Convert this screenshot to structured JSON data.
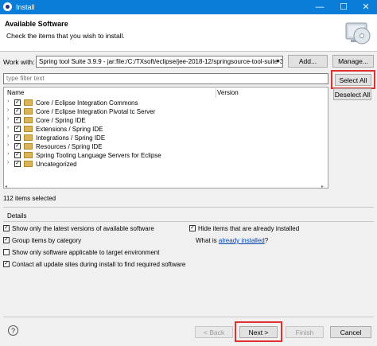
{
  "window": {
    "title": "Install",
    "minimize": "—",
    "maximize": "☐",
    "close": "✕"
  },
  "header": {
    "title": "Available Software",
    "subtitle": "Check the items that you wish to install."
  },
  "workwith": {
    "label": "Work with:",
    "value": "Spring tool Suite 3.9.9 - jar:file:/C:/TXsoft/eclipse/jee-2018-12/springsource-tool-suite-3",
    "add_label": "Add...",
    "manage_label": "Manage..."
  },
  "filter": {
    "placeholder": "type filter text"
  },
  "buttons": {
    "select_all": "Select All",
    "deselect_all": "Deselect All"
  },
  "tree": {
    "columns": [
      "Name",
      "Version"
    ],
    "items": [
      "Core / Eclipse Integration Commons",
      "Core / Eclipse Integration Pivotal tc Server",
      "Core / Spring IDE",
      "Extensions / Spring IDE",
      "Integrations / Spring IDE",
      "Resources / Spring IDE",
      "Spring Tooling Language Servers for Eclipse",
      "Uncategorized"
    ]
  },
  "status": {
    "selected": "112 items selected"
  },
  "details": {
    "label": "Details",
    "options": [
      {
        "label": "Show only the latest versions of available software",
        "checked": true
      },
      {
        "label": "Hide items that are already installed",
        "checked": true
      },
      {
        "label": "Group items by category",
        "checked": true
      },
      {
        "label": "Show only software applicable to target environment",
        "checked": false
      },
      {
        "label": "Contact all update sites during install to find required software",
        "checked": true
      }
    ],
    "what_is_prefix": "What is",
    "already_installed_link": "already installed",
    "what_is_suffix": "?"
  },
  "footer": {
    "back": "< Back",
    "next": "Next >",
    "finish": "Finish",
    "cancel": "Cancel",
    "help": "?"
  },
  "colors": {
    "titlebar": "#0a7dd8",
    "highlight": "#e03030",
    "link": "#0645ad"
  }
}
